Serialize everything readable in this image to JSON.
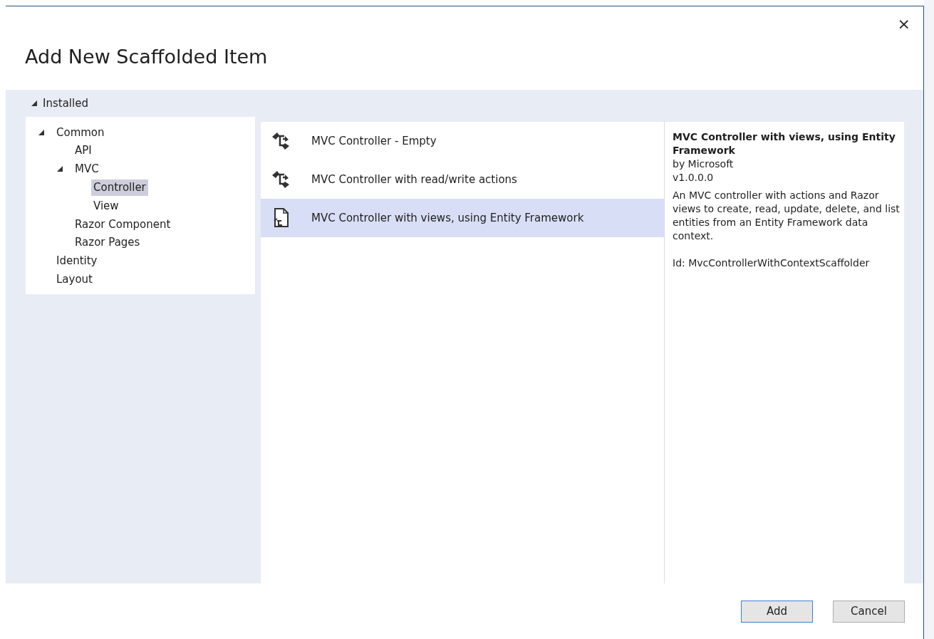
{
  "dialog": {
    "title": "Add New Scaffolded Item",
    "close": "×"
  },
  "installed": {
    "label": "Installed",
    "expanded": true
  },
  "tree": [
    {
      "label": "Common",
      "expanded": true,
      "selected": false,
      "children": [
        {
          "label": "API",
          "selected": false
        },
        {
          "label": "MVC",
          "expanded": true,
          "selected": false,
          "children": [
            {
              "label": "Controller",
              "selected": true
            },
            {
              "label": "View",
              "selected": false
            }
          ]
        },
        {
          "label": "Razor Component",
          "selected": false
        },
        {
          "label": "Razor Pages",
          "selected": false
        }
      ]
    },
    {
      "label": "Identity",
      "selected": false
    },
    {
      "label": "Layout",
      "selected": false
    }
  ],
  "templates": [
    {
      "name": "MVC Controller - Empty",
      "kind": "controller",
      "selected": false
    },
    {
      "name": "MVC Controller with read/write actions",
      "kind": "controller",
      "selected": false
    },
    {
      "name": "MVC Controller with views, using Entity Framework",
      "kind": "entity",
      "selected": true
    }
  ],
  "details": {
    "title": "MVC Controller with views, using Entity Framework",
    "author": "by Microsoft",
    "version": "v1.0.0.0",
    "description": "An MVC controller with actions and Razor views to create, read, update, delete, and list entities from an Entity Framework data context.",
    "id": "Id: MvcControllerWithContextScaffolder"
  },
  "buttons": [
    {
      "label": "Add",
      "kind": "primary"
    },
    {
      "label": "Cancel",
      "kind": "secondary"
    }
  ]
}
